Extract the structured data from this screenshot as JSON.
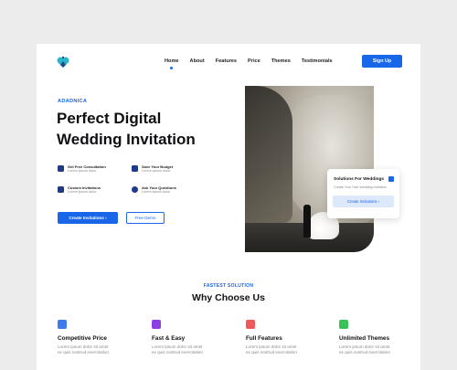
{
  "nav": {
    "items": [
      "Home",
      "About",
      "Features",
      "Price",
      "Themes",
      "Testimonials"
    ],
    "active": "Home",
    "signup": "Sign Up"
  },
  "hero": {
    "eyebrow": "ADADNICA",
    "title_line1": "Perfect Digital",
    "title_line2": "Wedding Invitation",
    "features": [
      {
        "title": "Get Free Consultation",
        "sub": "Lorem ipsum dolor",
        "icon": "chat-icon"
      },
      {
        "title": "Save Your Budget",
        "sub": "Lorem ipsum dolor",
        "icon": "wallet-icon"
      },
      {
        "title": "Custom Invitations",
        "sub": "Lorem ipsum dolor",
        "icon": "edit-icon"
      },
      {
        "title": "Ask Your Questions",
        "sub": "Lorem ipsum dolor",
        "icon": "help-icon"
      }
    ],
    "cta_primary": "Create Invitations  ›",
    "cta_secondary": "Free Demo"
  },
  "card": {
    "title": "Solutions For Weddings",
    "sub": "Create Your Own Wedding Invitation",
    "button": "Create Invitations  ›"
  },
  "section": {
    "eyebrow": "FASTEST SOLUTION",
    "title": "Why Choose Us",
    "columns": [
      {
        "title": "Competitive Price",
        "line1": "Lorem ipsum dolor sit amet",
        "line2": "ex quis nostrud exercitation",
        "icon": "price-icon",
        "color": "#3b7bea"
      },
      {
        "title": "Fast & Easy",
        "line1": "Lorem ipsum dolor sit amet",
        "line2": "ex quis nostrud exercitation",
        "icon": "bolt-icon",
        "color": "#8b3fe0"
      },
      {
        "title": "Full Features",
        "line1": "Lorem ipsum dolor sit amet",
        "line2": "ex quis nostrud exercitation",
        "icon": "grid-icon",
        "color": "#ef5a5a"
      },
      {
        "title": "Unlimited Themes",
        "line1": "Lorem ipsum dolor sit amet",
        "line2": "ex quis nostrud exercitation",
        "icon": "palette-icon",
        "color": "#39c25a"
      }
    ]
  },
  "colors": {
    "accent": "#1967e8",
    "background": "#ececec"
  }
}
